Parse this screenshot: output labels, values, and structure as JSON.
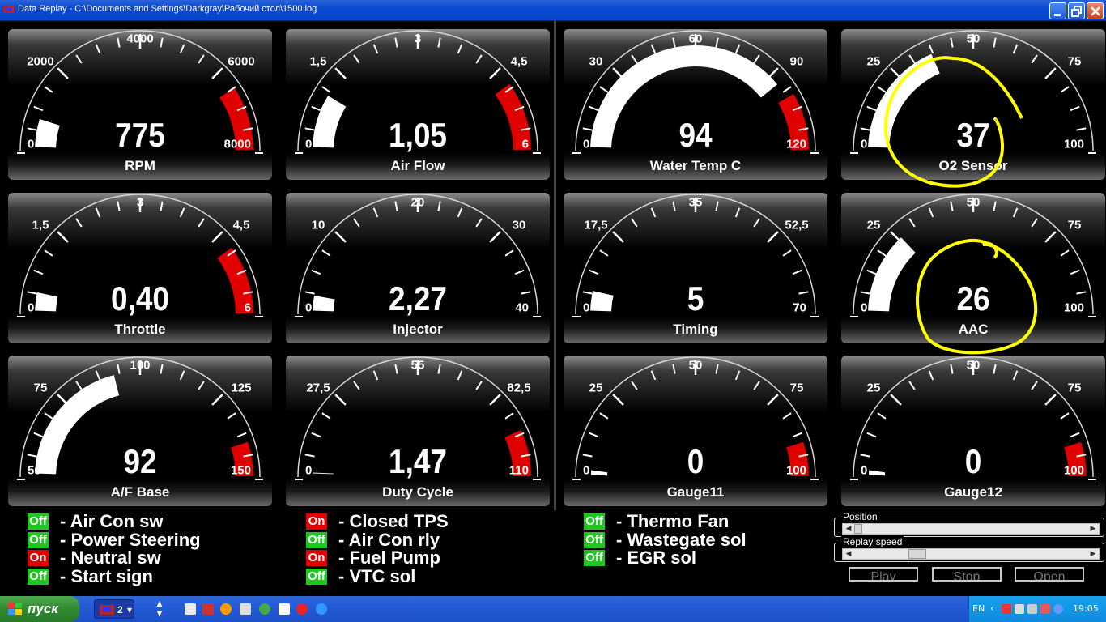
{
  "window": {
    "title": "Data Replay - C:\\Documents and Settings\\Darkgray\\Рабочий стол\\1500.log"
  },
  "gauges": [
    {
      "name": "RPM",
      "value": "775",
      "value_num": 775,
      "min": 0,
      "max": 8000,
      "redline": 6500,
      "ticks": [
        "0",
        "2000",
        "4000",
        "6000",
        "8000"
      ]
    },
    {
      "name": "Air Flow",
      "value": "1,05",
      "value_num": 1.05,
      "min": 0,
      "max": 6,
      "redline": 4.8,
      "ticks": [
        "0",
        "1,5",
        "3",
        "4,5",
        "6"
      ]
    },
    {
      "name": "Water Temp C",
      "value": "94",
      "value_num": 94,
      "min": 0,
      "max": 120,
      "redline": 100,
      "ticks": [
        "0",
        "30",
        "60",
        "90",
        "120"
      ]
    },
    {
      "name": "O2 Sensor",
      "value": "37",
      "value_num": 37,
      "min": 0,
      "max": 100,
      "redline": null,
      "ticks": [
        "0",
        "25",
        "50",
        "75",
        "100"
      ]
    },
    {
      "name": "Throttle",
      "value": "0,40",
      "value_num": 0.4,
      "min": 0,
      "max": 6,
      "redline": 4.8,
      "ticks": [
        "0",
        "1,5",
        "3",
        "4,5",
        "6"
      ]
    },
    {
      "name": "Injector",
      "value": "2,27",
      "value_num": 2.27,
      "min": 0,
      "max": 40,
      "redline": null,
      "ticks": [
        "0",
        "10",
        "20",
        "30",
        "40"
      ]
    },
    {
      "name": "Timing",
      "value": "5",
      "value_num": 5,
      "min": 0,
      "max": 70,
      "redline": null,
      "ticks": [
        "0",
        "17,5",
        "35",
        "52,5",
        "70"
      ]
    },
    {
      "name": "AAC",
      "value": "26",
      "value_num": 26,
      "min": 0,
      "max": 100,
      "redline": null,
      "ticks": [
        "0",
        "25",
        "50",
        "75",
        "100"
      ]
    },
    {
      "name": "A/F Base",
      "value": "92",
      "value_num": 92,
      "min": 50,
      "max": 150,
      "redline": 140,
      "ticks": [
        "50",
        "75",
        "100",
        "125",
        "150"
      ]
    },
    {
      "name": "Duty Cycle",
      "value": "1,47",
      "value_num": 1.47,
      "min": 0,
      "max": 110,
      "redline": 95,
      "ticks": [
        "0",
        "27,5",
        "55",
        "82,5",
        "110"
      ]
    },
    {
      "name": "Gauge11",
      "value": "0",
      "value_num": 0,
      "min": 0,
      "max": 100,
      "redline": 90,
      "ticks": [
        "0",
        "25",
        "50",
        "75",
        "100"
      ]
    },
    {
      "name": "Gauge12",
      "value": "0",
      "value_num": 0,
      "min": 0,
      "max": 100,
      "redline": 90,
      "ticks": [
        "0",
        "25",
        "50",
        "75",
        "100"
      ]
    }
  ],
  "status_indicators": [
    {
      "state": "Off",
      "label": "- Air Con sw"
    },
    {
      "state": "Off",
      "label": "- Power Steering"
    },
    {
      "state": "On",
      "label": "- Neutral sw"
    },
    {
      "state": "Off",
      "label": "- Start sign"
    },
    {
      "state": "On",
      "label": "- Closed TPS"
    },
    {
      "state": "Off",
      "label": "- Air Con rly"
    },
    {
      "state": "On",
      "label": "- Fuel Pump"
    },
    {
      "state": "Off",
      "label": "- VTC sol"
    },
    {
      "state": "Off",
      "label": "- Thermo Fan"
    },
    {
      "state": "Off",
      "label": "- Wastegate sol"
    },
    {
      "state": "Off",
      "label": "- EGR sol"
    }
  ],
  "controls": {
    "position_label": "Position",
    "position_value": 0.0,
    "replay_speed_label": "Replay speed",
    "replay_speed_value": 0.25,
    "play_label": "Play",
    "stop_label": "Stop",
    "open_label": "Open"
  },
  "taskbar": {
    "start_label": "пуск",
    "group_count": "2",
    "lang": "EN",
    "clock": "19:05"
  },
  "colors": {
    "redline": "#e00000",
    "arc_fill": "#ffffff",
    "status_on": "#e00000",
    "status_off": "#1ec81e",
    "annotation": "#ffff00"
  }
}
